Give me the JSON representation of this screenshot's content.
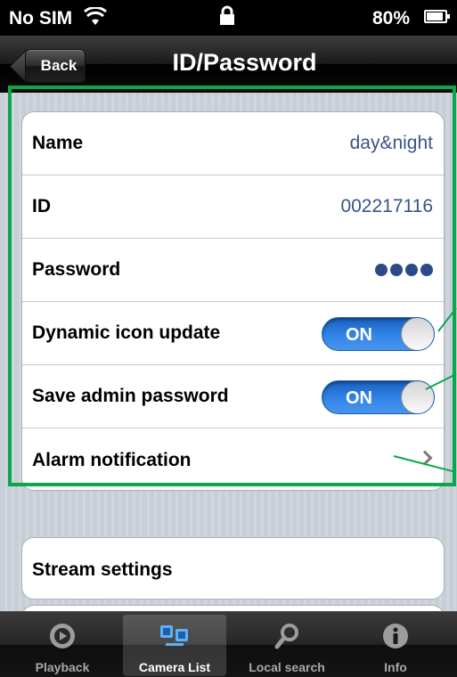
{
  "status_bar": {
    "carrier": "No SIM",
    "battery": "80%"
  },
  "nav": {
    "back_label": "Back",
    "title": "ID/Password"
  },
  "settings": {
    "name_label": "Name",
    "name_value": "day&night",
    "id_label": "ID",
    "id_value": "002217116",
    "password_label": "Password",
    "dynamic_icon_label": "Dynamic icon update",
    "dynamic_icon_toggle": "ON",
    "save_admin_label": "Save admin password",
    "save_admin_toggle": "ON",
    "alarm_label": "Alarm notification"
  },
  "stream": {
    "label": "Stream settings"
  },
  "tabs": [
    {
      "label": "Playback",
      "icon": "playback-icon"
    },
    {
      "label": "Camera List",
      "icon": "camera-list-icon",
      "active": true
    },
    {
      "label": "Local search",
      "icon": "search-icon"
    },
    {
      "label": "Info",
      "icon": "info-icon"
    }
  ],
  "colors": {
    "toggle_on": "#2f83e6",
    "value_text": "#385487",
    "highlight": "#0aa84a"
  }
}
